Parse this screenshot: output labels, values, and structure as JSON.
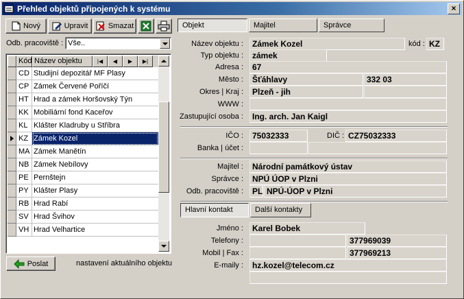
{
  "window": {
    "title": "Přehled objektů připojených k systému",
    "close": "×"
  },
  "toolbar": {
    "new": "Nový",
    "edit": "Upravit",
    "delete": "Smazat"
  },
  "filter": {
    "label": "Odb. pracoviště :",
    "value": "Vše.."
  },
  "grid": {
    "col_code": "Kód",
    "col_name": "Název objektu",
    "nav": [
      "|◀",
      "◀",
      "▶",
      "▶|"
    ],
    "rows": [
      {
        "kod": "CD",
        "name": "Studijní depozitář MF Plasy"
      },
      {
        "kod": "CP",
        "name": "Zámek Červené Poříčí"
      },
      {
        "kod": "HT",
        "name": "Hrad a zámek Horšovský Týn"
      },
      {
        "kod": "KK",
        "name": "Mobiliární fond Kaceřov"
      },
      {
        "kod": "KL",
        "name": "Klášter Kladruby u Stříbra"
      },
      {
        "kod": "KZ",
        "name": "Zámek Kozel"
      },
      {
        "kod": "MA",
        "name": "Zámek Manětín"
      },
      {
        "kod": "NB",
        "name": "Zámek Nebílovy"
      },
      {
        "kod": "PE",
        "name": "Pernštejn"
      },
      {
        "kod": "PY",
        "name": "Klášter Plasy"
      },
      {
        "kod": "RB",
        "name": "Hrad Rabí"
      },
      {
        "kod": "SV",
        "name": "Hrad Švihov"
      },
      {
        "kod": "VH",
        "name": "Hrad Velhartice"
      }
    ],
    "selected_index": 5
  },
  "bottom": {
    "send": "Poslat",
    "hint": "nastavení aktuálního objektu"
  },
  "tabs": [
    "Objekt",
    "Majitel",
    "Správce"
  ],
  "object": {
    "name_label": "Název objektu :",
    "name": "Zámek Kozel",
    "code_label": "kód :",
    "code": "KZ",
    "type_label": "Typ objektu :",
    "type": "zámek",
    "address_label": "Adresa :",
    "address": "67",
    "city_label": "Město :",
    "city": "Šťáhlavy",
    "zip": "332 03",
    "region_label": "Okres | Kraj :",
    "region": "Plzeň - jih",
    "www_label": "WWW :",
    "www": "",
    "rep_label": "Zastupující osoba :",
    "rep": "Ing. arch. Jan Kaigl",
    "ico_label": "IČO :",
    "ico": "75032333",
    "dic_label": "DIČ :",
    "dic": "CZ75032333",
    "bank_label": "Banka | účet :",
    "owner_label": "Majitel :",
    "owner": "Národní památkový ústav",
    "admin_label": "Správce :",
    "admin": "NPÚ ÚOP v Plzni",
    "workplace_label": "Odb. pracoviště :",
    "workplace_code": "PL",
    "workplace": "NPÚ-ÚOP v Plzni"
  },
  "contact_tabs": [
    "Hlavní kontakt",
    "Další kontakty"
  ],
  "contact": {
    "name_label": "Jméno :",
    "name": "Karel Bobek",
    "phone_label": "Telefony :",
    "phone": "377969039",
    "mobile_label": "Mobil | Fax :",
    "fax": "377969213",
    "email_label": "E-maily :",
    "email": "hz.kozel@telecom.cz"
  }
}
